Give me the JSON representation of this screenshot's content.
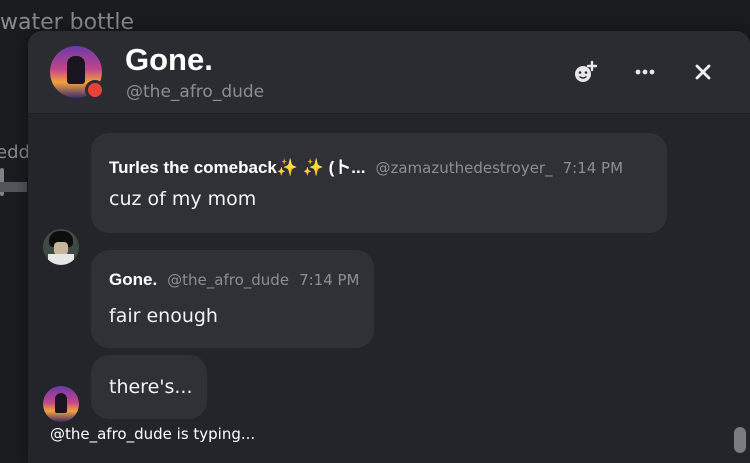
{
  "background": {
    "top_text": "water bottle",
    "side_text": "edd"
  },
  "chat": {
    "title": "Gone.",
    "handle": "@the_afro_dude",
    "status_color": "#e8413a",
    "header_icons": [
      "add-friend-icon",
      "more-icon",
      "close-icon"
    ]
  },
  "messages": [
    {
      "author": "Turles the comeback✨ ✨ (ト...",
      "handle": "@zamazuthedestroyer_",
      "time": "7:14 PM",
      "text": "cuz of my mom"
    },
    {
      "author": "Gone.",
      "handle": "@the_afro_dude",
      "time": "7:14 PM",
      "text": "fair enough"
    },
    {
      "text": "there's..."
    }
  ],
  "typing_indicator": "@the_afro_dude is typing..."
}
